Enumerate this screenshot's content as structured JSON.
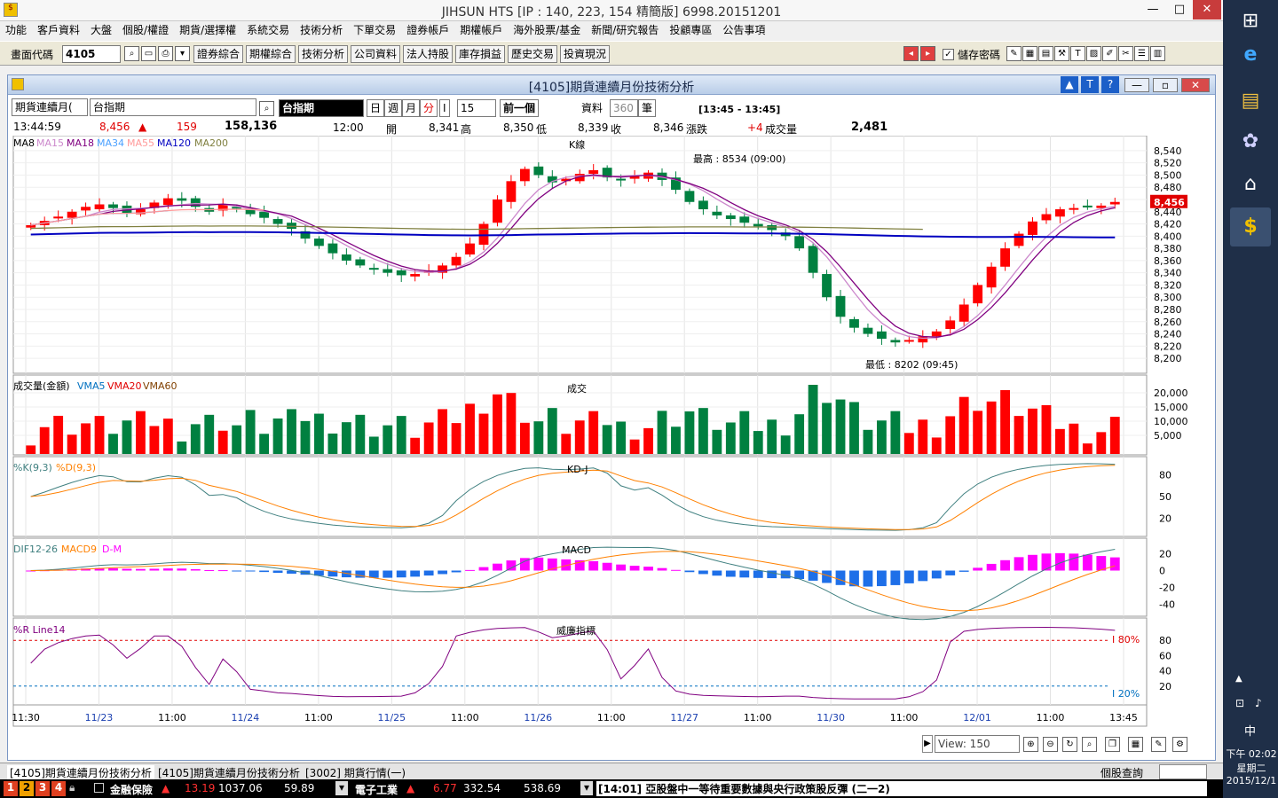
{
  "window": {
    "title": "JIHSUN HTS    [IP : 140, 223, 154 精簡版] 6998.20151201",
    "min": "—",
    "max": "□",
    "close": "✕"
  },
  "menu": [
    "功能",
    "客戶資料",
    "大盤",
    "個股/權證",
    "期貨/選擇權",
    "系統交易",
    "技術分析",
    "下單交易",
    "證券帳戶",
    "期權帳戶",
    "海外股票/基金",
    "新聞/研究報告",
    "投顧專區",
    "公告事項"
  ],
  "toolbar": {
    "code_label": "畫面代碼",
    "code_value": "4105",
    "buttons": [
      "證券綜合",
      "期權綜合",
      "技術分析",
      "公司資料",
      "法人持股",
      "庫存損益",
      "歷史交易",
      "投資現況"
    ],
    "save_pwd": "儲存密碼"
  },
  "inner": {
    "title": "[4105]期貨連續月份技術分析",
    "product_select": "期貨連續月(",
    "product_name": "台指期",
    "code_box": "台指期",
    "periods": [
      "日",
      "週",
      "月",
      "分",
      "I"
    ],
    "minutes": "15",
    "prev": "前一個",
    "data_label": "資料",
    "data_count": "360",
    "data_unit": "筆",
    "range": "[13:45 - 13:45]",
    "quote": {
      "time": "13:44:59",
      "price": "8,456",
      "change": "159",
      "volume": "158,136",
      "ctime": "12:00",
      "open_l": "開",
      "open": "8,341",
      "high_l": "高",
      "high": "8,350",
      "low_l": "低",
      "low": "8,339",
      "close_l": "收",
      "close": "8,346",
      "chg_l": "漲跌",
      "chg": "+4",
      "vol_l": "成交量",
      "vol": "2,481"
    }
  },
  "panels": {
    "kline": {
      "title": "K線",
      "legend": [
        "MA8",
        "MA15",
        "MA18",
        "MA34",
        "MA55",
        "MA120",
        "MA200"
      ],
      "high": "最高 : 8534 (09:00)",
      "low": "最低 : 8202 (09:45)",
      "current": "8,456"
    },
    "volume": {
      "title": "成交",
      "legend": [
        "成交量(金額)",
        "VMA5",
        "VMA20",
        "VMA60"
      ]
    },
    "kd": {
      "title": "KD-J",
      "legend": [
        "%K(9,3)",
        "%D(9,3)"
      ]
    },
    "macd": {
      "title": "MACD",
      "legend": [
        "DIF12-26",
        "MACD9",
        "D-M"
      ]
    },
    "wr": {
      "title": "威廉指標",
      "legend": [
        "%R Line14"
      ],
      "l80": "I 80%",
      "l20": "I 20%"
    }
  },
  "chart_data": [
    {
      "type": "candlestick",
      "title": "K線",
      "ylim": [
        8190,
        8550
      ],
      "yticks": [
        8540,
        8520,
        8500,
        8480,
        8460,
        8440,
        8420,
        8400,
        8380,
        8360,
        8340,
        8320,
        8300,
        8280,
        8260,
        8240,
        8220,
        8200
      ],
      "x": [
        "11:30",
        "11/23",
        "11:00",
        "11/24",
        "11:00",
        "11/25",
        "11:00",
        "11/26",
        "11:00",
        "11/27",
        "11:00",
        "11/30",
        "11:00",
        "12/01",
        "11:00",
        "13:45"
      ],
      "closes": [
        8418,
        8425,
        8432,
        8440,
        8448,
        8452,
        8446,
        8438,
        8444,
        8455,
        8462,
        8458,
        8448,
        8440,
        8452,
        8446,
        8436,
        8430,
        8420,
        8412,
        8396,
        8384,
        8372,
        8360,
        8352,
        8346,
        8340,
        8336,
        8338,
        8344,
        8352,
        8366,
        8388,
        8420,
        8460,
        8490,
        8510,
        8500,
        8488,
        8494,
        8502,
        8508,
        8496,
        8492,
        8498,
        8504,
        8492,
        8476,
        8456,
        8444,
        8434,
        8428,
        8422,
        8416,
        8410,
        8400,
        8380,
        8340,
        8300,
        8268,
        8250,
        8240,
        8232,
        8226,
        8230,
        8236,
        8244,
        8262,
        8288,
        8320,
        8350,
        8380,
        8404,
        8424,
        8436,
        8444,
        8446,
        8448,
        8450,
        8456
      ],
      "ma_lines": [
        "MA8",
        "MA15",
        "MA18",
        "MA34",
        "MA55",
        "MA120",
        "MA200"
      ]
    },
    {
      "type": "bar",
      "title": "成交",
      "ylim": [
        0,
        25000
      ],
      "yticks": [
        20000,
        15000,
        10000,
        5000
      ]
    },
    {
      "type": "line",
      "title": "KD-J",
      "ylim": [
        0,
        100
      ],
      "yticks": [
        80,
        50,
        20
      ]
    },
    {
      "type": "bar",
      "title": "MACD",
      "ylim": [
        -50,
        30
      ],
      "yticks": [
        20,
        0,
        -20,
        -40
      ]
    },
    {
      "type": "line",
      "title": "威廉指標",
      "ylim": [
        0,
        100
      ],
      "yticks": [
        80,
        60,
        40,
        20
      ]
    }
  ],
  "bottom": {
    "view": "View: 150"
  },
  "tabs": [
    "[4105]期貨連續月份技術分析",
    "[4105]期貨連續月份技術分析",
    "[3002]  期貨行情(一)"
  ],
  "tabs_right": "個股查詢",
  "ticker": {
    "nums": [
      "1",
      "2",
      "3",
      "4"
    ],
    "s1": "金融保險",
    "s1_dir": "▲",
    "s1_a": "13.19",
    "s1_b": "1037.06",
    "s1_c": "59.89",
    "s2": "電子工業",
    "s2_dir": "▲",
    "s2_a": "6.77",
    "s2_b": "332.54",
    "s2_c": "538.69",
    "news": "[14:01] 亞股盤中一等待重要數據與央行政策股反彈 (二一2)"
  },
  "taskbar": {
    "ime": "中",
    "time": "下午 02:02",
    "day": "星期二",
    "date": "2015/12/1"
  },
  "colors": {
    "up": "#ff0000",
    "down": "#008040",
    "ma8": "#000000",
    "ma15": "#cc88cc",
    "ma18": "#800080",
    "ma34": "#4aa0ff",
    "ma55": "#ff9999",
    "ma120": "#0000c0",
    "ma200": "#808040"
  }
}
